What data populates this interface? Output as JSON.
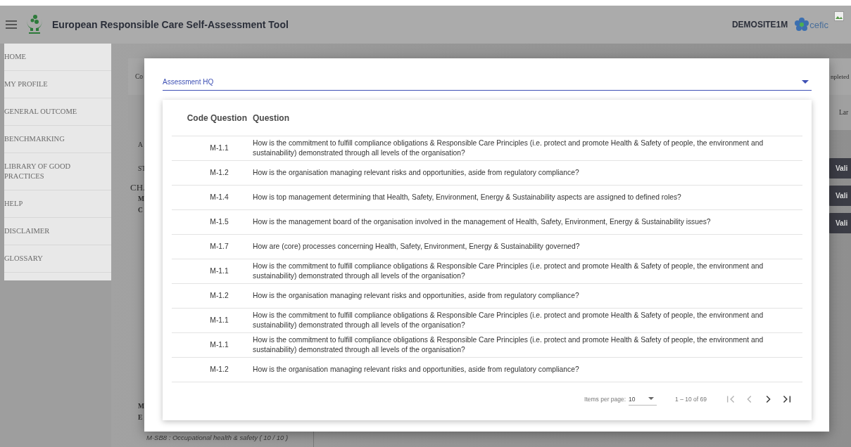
{
  "header": {
    "title": "European Responsible Care Self-Assessment Tool",
    "user": "DEMOSITE1M",
    "partner_logo_text": "cefic"
  },
  "sidebar": {
    "items": [
      {
        "label": "HOME"
      },
      {
        "label": "MY PROFILE"
      },
      {
        "label": "GENERAL OUTCOME"
      },
      {
        "label": "BENCHMARKING"
      },
      {
        "label": "LIBRARY OF GOOD PRACTICES"
      },
      {
        "label": "HELP"
      },
      {
        "label": "DISCLAIMER"
      },
      {
        "label": "GLOSSARY"
      }
    ]
  },
  "background": {
    "card_header_left": "Co",
    "card_header_right": "npleted",
    "column_header_right": "Lar",
    "rows_left": [
      "A",
      "ST"
    ],
    "chapter": "CH.",
    "chapter_lines": [
      "M",
      "C"
    ],
    "buttons": [
      "Vali",
      "Vali",
      "Vali"
    ],
    "bottom_lines": [
      "M",
      "E"
    ],
    "footnote": "M-SB8 : Occupational health & safety ( 10 / 10 )"
  },
  "dialog": {
    "select": {
      "value": "Assessment HQ"
    },
    "table": {
      "columns": [
        "Code Question",
        "Question"
      ],
      "rows": [
        {
          "code": "M-1.1",
          "question": "How is the commitment to fulfill compliance obligations & Responsible Care Principles (i.e. protect and promote Health & Safety of people, the environment and sustainability) demonstrated through all levels of the organisation?"
        },
        {
          "code": "M-1.2",
          "question": "How is the organisation managing relevant risks and opportunities, aside from regulatory compliance?"
        },
        {
          "code": "M-1.4",
          "question": "How is top management determining that Health, Safety, Environment, Energy & Sustainability aspects are assigned to defined roles?"
        },
        {
          "code": "M-1.5",
          "question": "How is the management board of the organisation involved in the management of Health, Safety, Environment, Energy & Sustainability issues?"
        },
        {
          "code": "M-1.7",
          "question": "How are (core) processes concerning Health, Safety, Environment, Energy & Sustainability governed?"
        },
        {
          "code": "M-1.1",
          "question": "How is the commitment to fulfill compliance obligations & Responsible Care Principles (i.e. protect and promote Health & Safety of people, the environment and sustainability) demonstrated through all levels of the organisation?"
        },
        {
          "code": "M-1.2",
          "question": "How is the organisation managing relevant risks and opportunities, aside from regulatory compliance?"
        },
        {
          "code": "M-1.1",
          "question": "How is the commitment to fulfill compliance obligations & Responsible Care Principles (i.e. protect and promote Health & Safety of people, the environment and sustainability) demonstrated through all levels of the organisation?"
        },
        {
          "code": "M-1.1",
          "question": "How is the commitment to fulfill compliance obligations & Responsible Care Principles (i.e. protect and promote Health & Safety of people, the environment and sustainability) demonstrated through all levels of the organisation?"
        },
        {
          "code": "M-1.2",
          "question": "How is the organisation managing relevant risks and opportunities, aside from regulatory compliance?"
        }
      ]
    },
    "paginator": {
      "items_per_page_label": "Items per page:",
      "page_size": "10",
      "range": "1 – 10 of 69",
      "buttons": [
        {
          "kind": "first",
          "disabled": true
        },
        {
          "kind": "prev",
          "disabled": true
        },
        {
          "kind": "next",
          "disabled": false
        },
        {
          "kind": "last",
          "disabled": false
        }
      ]
    }
  }
}
